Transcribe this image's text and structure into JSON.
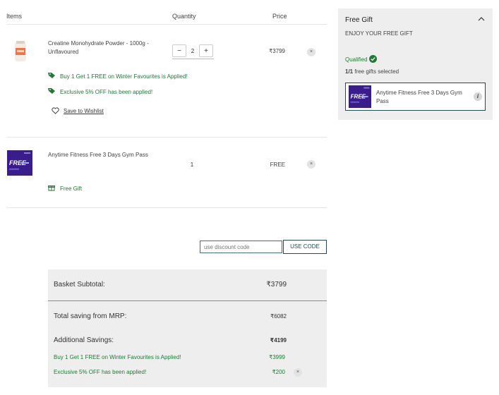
{
  "table_header": {
    "items": "Items",
    "quantity": "Quantity",
    "price": "Price"
  },
  "cart_items": [
    {
      "name_line1": "Creatine Monohydrate Powder - 1000g -",
      "name_line2": "Unflavoured",
      "quantity": "2",
      "decrement": "−",
      "increment": "+",
      "price": "₹3799",
      "remove": "×",
      "offers": [
        "Buy 1 Get 1 FREE on Winter Favourites is Applied!",
        "Exclusive 5% OFF has been applied!"
      ],
      "wishlist_label": "Save to Wishlist"
    },
    {
      "name_line1": "Anytime Fitness Free 3 Days Gym Pass",
      "quantity": "1",
      "price": "FREE",
      "remove": "×",
      "badge": "Free Gift"
    }
  ],
  "discount": {
    "placeholder": "use discount code",
    "button_label": "USE CODE"
  },
  "summary": {
    "subtotal_label": "Basket Subtotal:",
    "subtotal_value": "₹3799",
    "saving_label": "Total saving from MRP:",
    "saving_value": "₹6082",
    "additional_label": "Additional Savings:",
    "additional_value": "₹4199",
    "lines": [
      {
        "label": "Buy 1 Get 1 FREE on Winter Favourites is Applied!",
        "value": "₹3999"
      },
      {
        "label": "Exclusive 5% OFF has been applied!",
        "value": "₹200",
        "remove": "×"
      }
    ]
  },
  "free_gift": {
    "title": "Free Gift",
    "subtitle": "ENJOY YOUR FREE GIFT",
    "status": "Qualified",
    "count_bold": "1/1",
    "count_rest": " free gifts selected",
    "gift_name_line1": "Anytime Fitness Free 3 Days Gym",
    "gift_name_line2": "Pass",
    "info": "i"
  },
  "thumb_text": "FREE",
  "colors": {
    "accent_green": "#1f7a36",
    "brand_teal": "#234a55",
    "gym_purple": "#3a1c8c"
  }
}
